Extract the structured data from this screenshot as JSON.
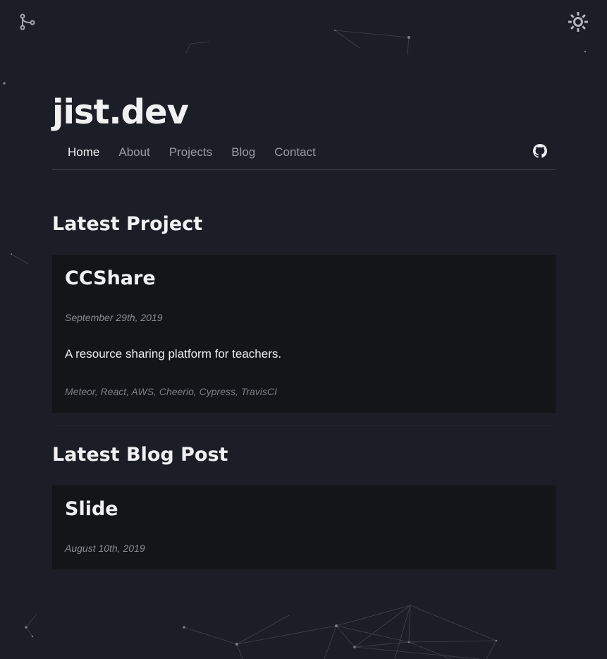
{
  "site": {
    "title": "jist.dev"
  },
  "nav": {
    "items": [
      {
        "label": "Home",
        "active": true
      },
      {
        "label": "About",
        "active": false
      },
      {
        "label": "Projects",
        "active": false
      },
      {
        "label": "Blog",
        "active": false
      },
      {
        "label": "Contact",
        "active": false
      }
    ],
    "github_icon": "github-icon"
  },
  "corner": {
    "left_icon": "git-branch-icon",
    "right_icon": "sun-gear-icon"
  },
  "latest_project": {
    "heading": "Latest Project",
    "title": "CCShare",
    "date": "September 29th, 2019",
    "description": "A resource sharing platform for teachers.",
    "tags": "Meteor, React, AWS, Cheerio, Cypress, TravisCI"
  },
  "latest_blog": {
    "heading": "Latest Blog Post",
    "title": "Slide",
    "date": "August 10th, 2019"
  },
  "colors": {
    "background": "#1b1e27",
    "card": "#141519",
    "text": "#f1f1f3",
    "muted": "#8a8c93"
  }
}
